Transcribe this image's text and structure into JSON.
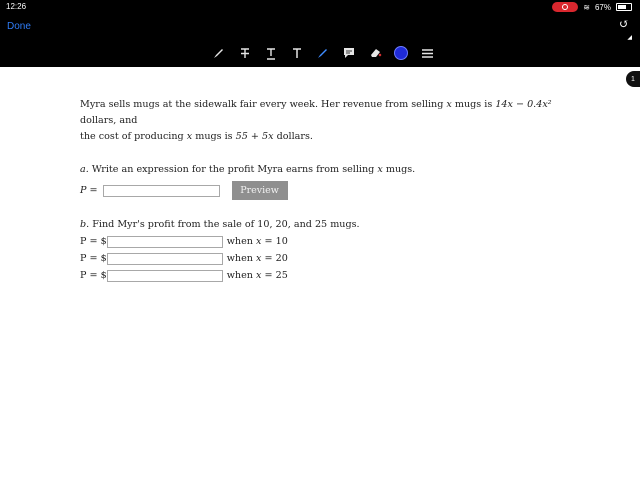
{
  "status_bar": {
    "time": "12:26",
    "battery": "67%",
    "battery_level": 0.67
  },
  "nav": {
    "done_label": "Done"
  },
  "toolbar": {
    "tools": [
      "pen-icon",
      "strikethrough-text-icon",
      "underline-text-icon",
      "text-icon",
      "highlighter-icon",
      "comment-icon",
      "eraser-icon",
      "color-picker-icon",
      "menu-icon"
    ],
    "active_color": "#1f2bd8"
  },
  "page_indicator": "1",
  "problem": {
    "intro_line1_a": "Myra sells mugs at the sidewalk fair every week. Her revenue from selling ",
    "intro_var": "x",
    "intro_line1_b": " mugs is ",
    "revenue_expr": "14x − 0.4x²",
    "intro_line1_c": " dollars, and",
    "intro_line2_a": "the cost of producing ",
    "intro_line2_b": " mugs is ",
    "cost_expr": "55 + 5x",
    "intro_line2_c": " dollars."
  },
  "part_a": {
    "label": "a.",
    "text": "Write an expression for the profit Myra earns from selling ",
    "text_var": "x",
    "text_end": " mugs.",
    "p_label": "P =",
    "input_value": "",
    "preview_label": "Preview"
  },
  "part_b": {
    "label": "b.",
    "text": "Find Myr's profit from the sale of 10, 20, and 25 mugs.",
    "rows": [
      {
        "p_label": "P = $",
        "when": "when",
        "var": "x",
        "eq": "= 10",
        "value": ""
      },
      {
        "p_label": "P = $",
        "when": "when",
        "var": "x",
        "eq": "= 20",
        "value": ""
      },
      {
        "p_label": "P = $",
        "when": "when",
        "var": "x",
        "eq": "= 25",
        "value": ""
      }
    ]
  }
}
